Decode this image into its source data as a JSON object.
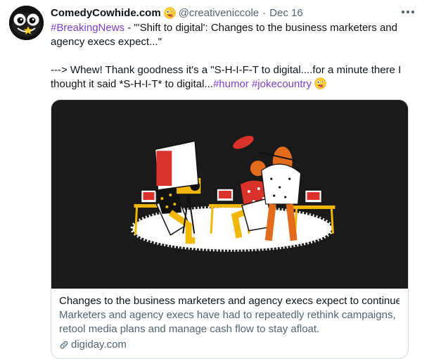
{
  "tweet": {
    "display_name": "ComedyCowhide.com",
    "handle": "@creativeniccole",
    "separator": "·",
    "date": "Dec 16",
    "hashtag1": "#BreakingNews",
    "line1_rest": " - \"'Shift to digital': Changes to the business marketers and agency execs expect...\"",
    "line2": "---> Whew! Thank goodness it's a \"S-H-I-F-T to digital....for a minute there I thought it said *S-H-I-T* to digital...",
    "hashtag2": "#humor",
    "hashtag3": "#jokecountry"
  },
  "card": {
    "title": "Changes to the business marketers and agency execs expect to continue",
    "description": "Marketers and agency execs have had to repeatedly rethink campaigns, retool media plans and manage cash flow to stay afloat.",
    "domain": "digiday.com"
  },
  "colors": {
    "hashtag": "#7e3fcf",
    "secondary_text": "#536471",
    "card_border": "#cfd9de",
    "card_image_bg": "#1a1a1a"
  },
  "icons": {
    "emoji": "zany-face-emoji-icon",
    "more": "more-dots-icon",
    "link": "link-icon"
  }
}
